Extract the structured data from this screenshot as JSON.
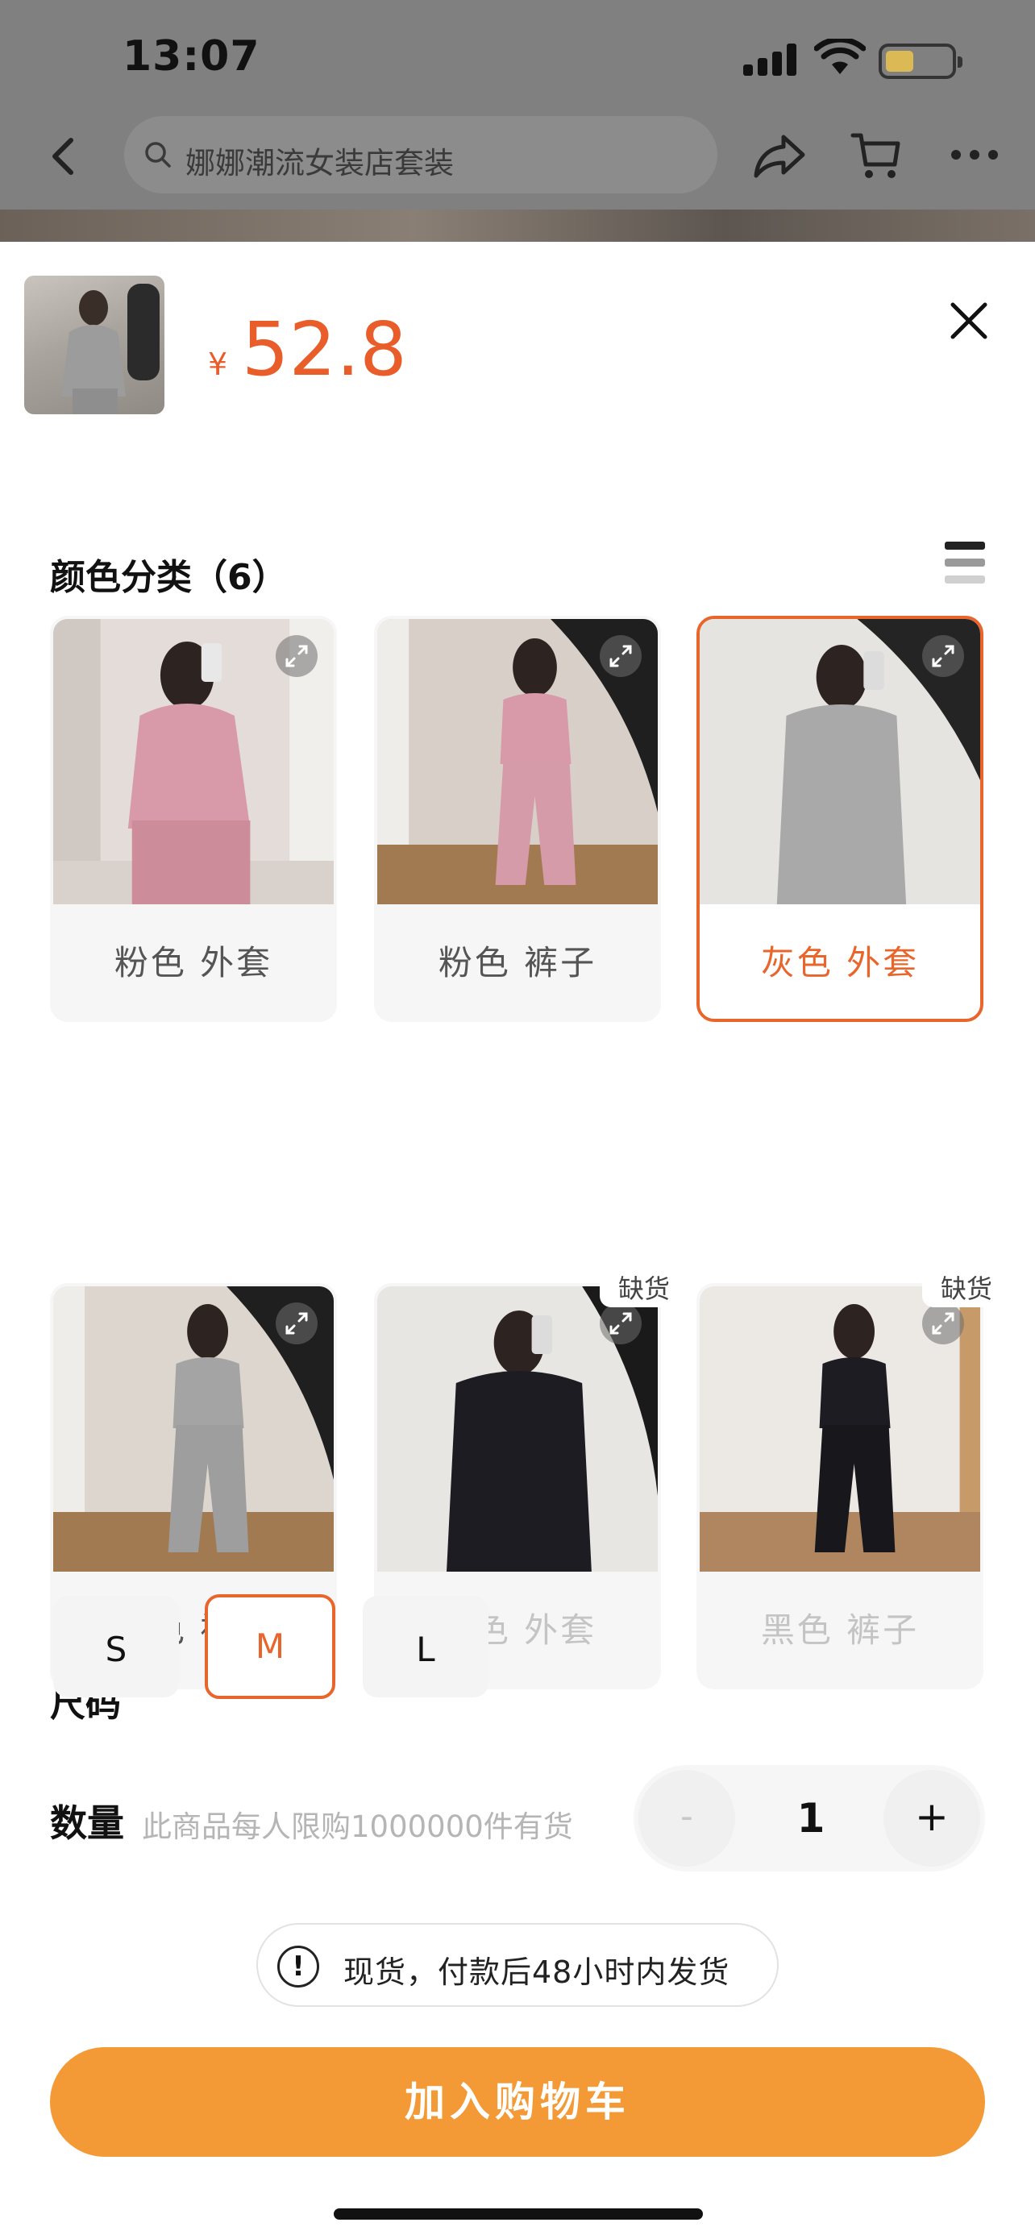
{
  "status_bar": {
    "time": "13:07"
  },
  "search": {
    "placeholder": "娜娜潮流女装店套装"
  },
  "product": {
    "currency": "¥",
    "price": "52.8"
  },
  "color_section": {
    "title": "颜色分类（6）",
    "options": [
      {
        "label": "粉色 外套",
        "selected": false,
        "out_of_stock": false
      },
      {
        "label": "粉色 裤子",
        "selected": false,
        "out_of_stock": false
      },
      {
        "label": "灰色 外套",
        "selected": true,
        "out_of_stock": false
      },
      {
        "label": "灰色 裤子",
        "selected": false,
        "out_of_stock": false
      },
      {
        "label": "黑色 外套",
        "selected": false,
        "out_of_stock": true
      },
      {
        "label": "黑色 裤子",
        "selected": false,
        "out_of_stock": true
      }
    ],
    "out_of_stock_tag": "缺货"
  },
  "size_section": {
    "title": "尺码",
    "options": [
      {
        "label": "S",
        "selected": false
      },
      {
        "label": "M",
        "selected": true
      },
      {
        "label": "L",
        "selected": false
      }
    ]
  },
  "quantity": {
    "label": "数量",
    "note": "此商品每人限购1000000件有货",
    "minus": "-",
    "value": "1",
    "plus": "+"
  },
  "notice": {
    "icon": "!",
    "text": "现货，付款后48小时内发货"
  },
  "add_to_cart": {
    "label": "加入购物车"
  },
  "colors": {
    "accent": "#e8662c",
    "button": "#f39a36",
    "price": "#e85d2a"
  }
}
